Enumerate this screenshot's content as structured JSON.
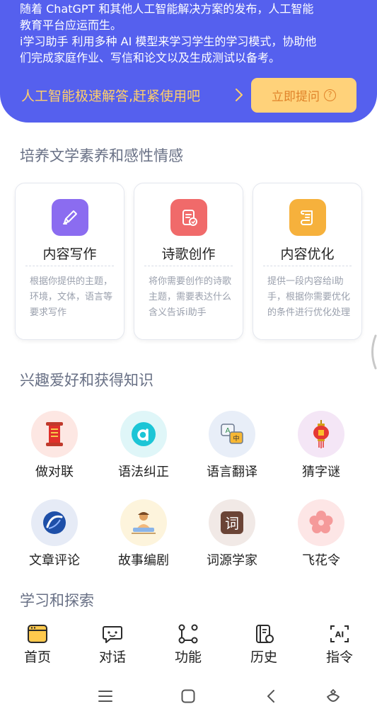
{
  "hero": {
    "line1": "随着 ChatGPT 和其他人工智能解决方案的发布，人工智能",
    "line2": "教育平台应运而生。",
    "line3": " i学习助手 利用多种 AI 模型来学习学生的学习模式，协助他",
    "line4": "们完成家庭作业、写信和论文以及生成测试以备考。",
    "cta_text": "人工智能极速解答,赶紧使用吧",
    "ask_button": "立即提问",
    "ask_icon": "?"
  },
  "section1": {
    "title": "培养文学素养和感性情感",
    "cards": [
      {
        "title": "内容写作",
        "desc": "根据你提供的主题，环境，文体，语言等要求写作",
        "icon": "pen-icon",
        "color": "#8b6cf0"
      },
      {
        "title": "诗歌创作",
        "desc": "将你需要创作的诗歌主题，需要表达什么含义告诉i助手",
        "icon": "poem-doc-icon",
        "color": "#f06a6a"
      },
      {
        "title": "内容优化",
        "desc": "提供一段内容给i助手，根据你需要优化的条件进行优化处理",
        "icon": "scroll-icon",
        "color": "#f6b13c"
      }
    ]
  },
  "section2": {
    "title": "兴趣爱好和获得知识",
    "items": [
      {
        "label": "做对联",
        "icon": "couplet-scroll-icon"
      },
      {
        "label": "语法纠正",
        "icon": "grammar-a-icon"
      },
      {
        "label": "语言翻译",
        "icon": "translate-icon"
      },
      {
        "label": "猜字谜",
        "icon": "lantern-icon"
      },
      {
        "label": "文章评论",
        "icon": "comment-globe-icon"
      },
      {
        "label": "故事编剧",
        "icon": "storyteller-icon"
      },
      {
        "label": "词源学家",
        "icon": "ci-character-icon",
        "glyph": "词"
      },
      {
        "label": "飞花令",
        "icon": "flower-icon"
      }
    ]
  },
  "section3": {
    "title": "学习和探索"
  },
  "tabbar": {
    "tabs": [
      {
        "label": "首页",
        "icon": "home-window-icon",
        "active": true
      },
      {
        "label": "对话",
        "icon": "chat-icon"
      },
      {
        "label": "功能",
        "icon": "function-nodes-icon"
      },
      {
        "label": "历史",
        "icon": "history-book-icon"
      },
      {
        "label": "指令",
        "icon": "ai-command-icon",
        "glyph": "AI"
      }
    ]
  },
  "colors": {
    "hero_bg": "#5560ee",
    "cta": "#ffcf6b",
    "ask_bg": "#ffd27a",
    "ask_text": "#e0832a"
  }
}
